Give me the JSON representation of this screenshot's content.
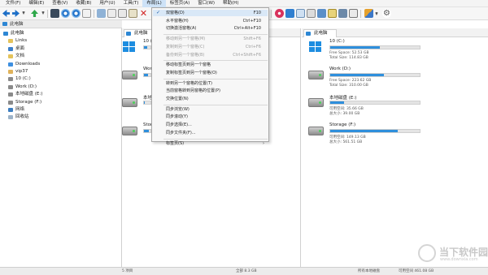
{
  "menubar": {
    "items": [
      "文件(F)",
      "编辑(E)",
      "查看(V)",
      "收藏(B)",
      "用户(U)",
      "工具(T)",
      "布局(L)",
      "标签页(A)",
      "窗口(W)",
      "帮助(H)"
    ]
  },
  "colors": {
    "accent": "#2d87d4",
    "bar_fill": "#2e8fdc",
    "menu_highlight": "#cde2f7"
  },
  "left_path": "此电脑",
  "tree": [
    {
      "label": "此电脑",
      "icon": "computer-icon",
      "level": 0
    },
    {
      "label": "Links",
      "icon": "folder-icon",
      "level": 1
    },
    {
      "label": "桌面",
      "icon": "desktop-icon",
      "level": 1
    },
    {
      "label": "文档",
      "icon": "folder-icon",
      "level": 1
    },
    {
      "label": "Downloads",
      "icon": "download-icon",
      "level": 1
    },
    {
      "label": "vip37",
      "icon": "user-icon",
      "level": 1
    },
    {
      "label": "10 (C:)",
      "icon": "drive-icon",
      "level": 1
    },
    {
      "label": "Work (D:)",
      "icon": "drive-icon",
      "level": 1
    },
    {
      "label": "本地磁盘 (E:)",
      "icon": "drive-icon",
      "level": 1
    },
    {
      "label": "Storage (F:)",
      "icon": "drive-icon",
      "level": 1
    },
    {
      "label": "网络",
      "icon": "network-icon",
      "level": 1
    },
    {
      "label": "回收站",
      "icon": "recycle-bin-icon",
      "level": 1
    }
  ],
  "middle_panel": {
    "tab": "此电脑",
    "drives": [
      {
        "name": "10 (C:)",
        "icon": "windows-drive-icon",
        "fill": 0.55
      },
      {
        "name": "Work",
        "icon": "hdd-icon",
        "fill": 0.6
      },
      {
        "name": "本地",
        "icon": "hdd-icon",
        "fill": 0.15
      },
      {
        "name": "Stora",
        "icon": "hdd-icon",
        "fill": 0.75
      }
    ]
  },
  "right_panel": {
    "tab": "此电脑",
    "drives": [
      {
        "name": "10 (C:)",
        "icon": "windows-drive-icon",
        "fill": 0.55,
        "free": "Free Space: 52.53 GB",
        "total": "Total Size: 114.83 GB"
      },
      {
        "name": "Work (D:)",
        "icon": "hdd-icon",
        "fill": 0.6,
        "free": "Free Space: 223.62 GB",
        "total": "Total Size: 310.00 GB"
      },
      {
        "name": "本地磁盘 (E:)",
        "icon": "hdd-icon",
        "fill": 0.15,
        "free": "可用空间: 35.66 GB",
        "total": "总大小: 39.00 GB"
      },
      {
        "name": "Storage (F:)",
        "icon": "hdd-icon",
        "fill": 0.75,
        "free": "可用空间: 149.13 GB",
        "total": "总大小: 561.51 GB"
      }
    ]
  },
  "dropdown": {
    "items": [
      {
        "label": "双窗格(D)",
        "shortcut": "F10",
        "checked": true,
        "disabled": false
      },
      {
        "label": "水平窗格(H)",
        "shortcut": "Ctrl+F10",
        "checked": false,
        "disabled": false
      },
      {
        "label": "切换激活窗格(A)",
        "shortcut": "Ctrl+Alt+F10",
        "checked": false,
        "disabled": false
      },
      {
        "sep": true
      },
      {
        "label": "移动到另一个窗格(M)",
        "shortcut": "Shift+F6",
        "checked": false,
        "disabled": true
      },
      {
        "label": "复制到另一个窗格(C)",
        "shortcut": "Ctrl+F6",
        "checked": false,
        "disabled": true
      },
      {
        "label": "备份到另一个窗格(B)",
        "shortcut": "Ctrl+Shift+F6",
        "checked": false,
        "disabled": true
      },
      {
        "sep": true
      },
      {
        "label": "移动标签页到另一个窗格",
        "shortcut": "",
        "checked": false,
        "disabled": false
      },
      {
        "label": "复制标签页到另一个窗格(O)",
        "shortcut": "",
        "checked": false,
        "disabled": false
      },
      {
        "sep": true
      },
      {
        "label": "转到另一个窗格的位置(T)",
        "shortcut": "",
        "checked": false,
        "disabled": false
      },
      {
        "label": "当前窗格转到另窗格的位置(P)",
        "shortcut": "",
        "checked": false,
        "disabled": false
      },
      {
        "label": "交换位置(N)",
        "shortcut": "",
        "checked": false,
        "disabled": false
      },
      {
        "sep": true
      },
      {
        "label": "同步浏览(W)",
        "shortcut": "",
        "checked": false,
        "disabled": false
      },
      {
        "label": "同步滚动(Y)",
        "shortcut": "",
        "checked": false,
        "disabled": false
      },
      {
        "label": "同步选择(E)...",
        "shortcut": "",
        "checked": false,
        "disabled": false
      },
      {
        "label": "同步文件夹(F)...",
        "shortcut": "",
        "checked": false,
        "disabled": false
      },
      {
        "sep": true
      },
      {
        "label": "标签页(S)",
        "shortcut": "",
        "checked": false,
        "disabled": false,
        "submenu": true
      }
    ]
  },
  "status": {
    "left": "5 项目",
    "middle": "全部 8.3 GB",
    "right1": "所有本地磁盘",
    "right2": "可用空间 461.08 GB"
  },
  "watermark": {
    "title": "当下软件园",
    "url": "www.downxia.com"
  }
}
